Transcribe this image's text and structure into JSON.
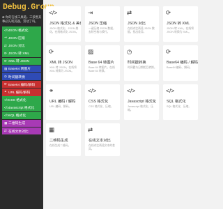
{
  "brand": {
    "logo": "Debug.Group",
    "tagline": "✿ 你的在线工具箱，工欲善其事必先利其器，劳动了吗。"
  },
  "sidebar": {
    "items": [
      {
        "label": "JSON 格式化",
        "icon": "code-icon",
        "color": "#2ea84a"
      },
      {
        "label": "JSON 压缩",
        "icon": "shrink-icon",
        "color": "#2ea84a"
      },
      {
        "label": "JSON 对比",
        "icon": "compare-icon",
        "color": "#2ea84a"
      },
      {
        "label": "JSON 转 XML",
        "icon": "sync-icon",
        "color": "#2ea84a"
      },
      {
        "label": "XML 转 JSON",
        "icon": "sync-icon",
        "color": "#2ea84a"
      },
      {
        "label": "Base64 转图片",
        "icon": "image-icon",
        "color": "#2f4bb5"
      },
      {
        "label": "时间戳转换",
        "icon": "clock-icon",
        "color": "#2f4bb5"
      },
      {
        "label": "Base64 编码/解码",
        "icon": "sync-icon",
        "color": "#c83030"
      },
      {
        "label": "URL 编码/解码",
        "icon": "link-icon",
        "color": "#c83030"
      },
      {
        "label": "CSS 格式化",
        "icon": "code-icon",
        "color": "#2ea84a"
      },
      {
        "label": "Javascript 格式化",
        "icon": "code-icon",
        "color": "#2ea84a"
      },
      {
        "label": "SQL 格式化",
        "icon": "code-icon",
        "color": "#2ea84a"
      },
      {
        "label": "二维码生成",
        "icon": "qrcode-icon",
        "color": "#a83ab5"
      },
      {
        "label": "在线文本对比",
        "icon": "compare-icon",
        "color": "#a83ab5"
      }
    ]
  },
  "cards": [
    {
      "title": "JSON 格式化 & 美化",
      "desc": "JSON 格式化，JSON 美化，在线格式化 JSON。",
      "icon": "code-icon"
    },
    {
      "title": "JSON 压缩",
      "desc": "一键压缩 JSON 数据，去除空格与换行。",
      "icon": "shrink-icon"
    },
    {
      "title": "JSON 对比",
      "desc": "在线对比两段 JSON 数据，找出差异。",
      "icon": "compare-icon"
    },
    {
      "title": "JSON 转 XML",
      "desc": "JSON 转 XML，在线将 JSON 转换为 XML。",
      "icon": "sync-icon"
    },
    {
      "title": "XML 转 JSON",
      "desc": "XML 转 JSON，在线将 XML 转换为 JSON。",
      "icon": "sync-icon"
    },
    {
      "title": "Base 64 转图片",
      "desc": "Base 64 转图片，在线 Base 64 转换。",
      "icon": "image-icon"
    },
    {
      "title": "时间戳转换",
      "desc": "时间戳与日期相互转换。",
      "icon": "clock-icon"
    },
    {
      "title": "Base64 编码 / 解码",
      "desc": "Base64 编码、解码。",
      "icon": "sync-icon"
    },
    {
      "title": "URL 编码 / 解码",
      "desc": "URL 编码、解码。",
      "icon": "link-icon"
    },
    {
      "title": "CSS 格式化",
      "desc": "CSS 格式化、压缩。",
      "icon": "code-icon"
    },
    {
      "title": "Javascript 格式化",
      "desc": "Javascript 格式化、压缩。",
      "icon": "code-icon"
    },
    {
      "title": "SQL 格式化",
      "desc": "SQL 格式化、压缩。",
      "icon": "code-icon"
    },
    {
      "title": "二维码生成",
      "desc": "在线生成二维码。",
      "icon": "qrcode-icon"
    },
    {
      "title": "在线文本对比",
      "desc": "在线对比两段文本的差异。",
      "icon": "compare-icon"
    }
  ]
}
